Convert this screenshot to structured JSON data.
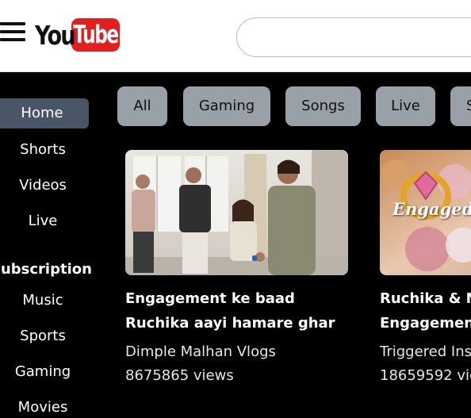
{
  "header": {
    "logo_left": "You",
    "logo_right": "Tube",
    "search_value": ""
  },
  "sidebar": {
    "items": [
      {
        "label": "Home",
        "active": true
      },
      {
        "label": "Shorts"
      },
      {
        "label": "Videos"
      },
      {
        "label": "Live"
      }
    ],
    "subscription_heading": "Subscription",
    "sub_items": [
      {
        "label": "Music"
      },
      {
        "label": "Sports"
      },
      {
        "label": "Gaming"
      },
      {
        "label": "Movies"
      }
    ]
  },
  "chips": [
    {
      "label": "All"
    },
    {
      "label": "Gaming"
    },
    {
      "label": "Songs"
    },
    {
      "label": "Live"
    },
    {
      "label": "S"
    }
  ],
  "videos": [
    {
      "title": "Engagement ke baad Ruchika aayi hamare ghar",
      "channel": "Dimple Malhan Vlogs",
      "views": "8675865 views"
    },
    {
      "title": "Ruchika & N Engagement",
      "channel": "Triggered Ins",
      "views": "18659592 vie",
      "thumb_text": "Engaged"
    }
  ],
  "colors": {
    "accent_red": "#e02020",
    "chip_bg": "#9aa0a8",
    "active_nav_bg": "#4a5568",
    "page_bg": "#000000"
  }
}
